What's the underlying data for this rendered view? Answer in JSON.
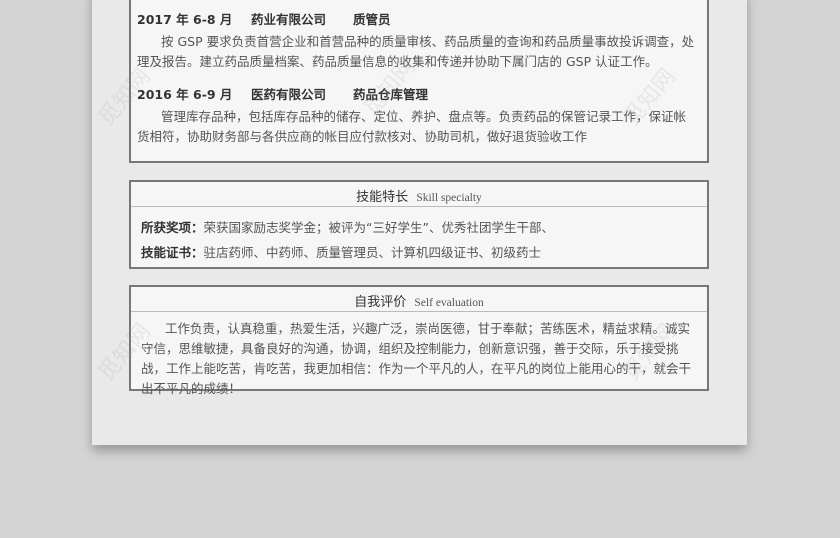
{
  "work": {
    "jobs": [
      {
        "period": "2017 年 6-8 月",
        "company": "药业有限公司",
        "position": "质管员",
        "description": "按 GSP 要求负责首营企业和首营品种的质量审核、药品质量的查询和药品质量事故投诉调查，处理及报告。建立药品质量档案、药品质量信息的收集和传递并协助下属门店的 GSP 认证工作。"
      },
      {
        "period": "2016 年 6-9 月",
        "company": "医药有限公司",
        "position": "药品仓库管理",
        "description": "管理库存品种，包括库存品种的储存、定位、养护、盘点等。负责药品的保管记录工作，保证帐货相符，协助财务部与各供应商的帐目应付款核对、协助司机，做好退货验收工作"
      }
    ]
  },
  "skills": {
    "title_cn": "技能特长",
    "title_en": "Skill specialty",
    "award_label": "所获奖项：",
    "award_value": "荣获国家励志奖学金；被评为“三好学生”、优秀社团学生干部、",
    "cert_label": "技能证书：",
    "cert_value": "驻店药师、中药师、质量管理员、计算机四级证书、初级药士"
  },
  "self_eval": {
    "title_cn": "自我评价",
    "title_en": "Self evaluation",
    "text": "工作负责，认真稳重，热爱生活，兴趣广泛，崇尚医德，甘于奉献；苦练医术，精益求精。诚实守信，思维敏捷，具备良好的沟通，协调，组织及控制能力，创新意识强，善于交际，乐于接受挑战，工作上能吃苦，肯吃苦，我更加相信：作为一个平凡的人，在平凡的岗位上能用心的干，就会干出不平凡的成绩！"
  },
  "watermark": "觅知网"
}
